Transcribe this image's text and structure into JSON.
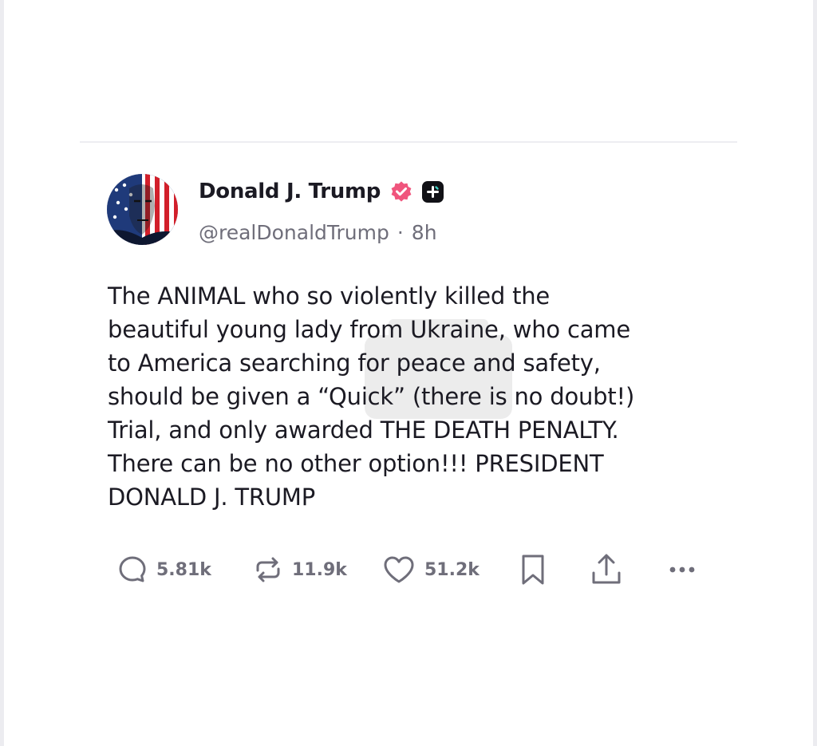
{
  "post": {
    "author_name": "Donald J. Trump",
    "handle": "@realDonaldTrump",
    "separator": "·",
    "time": "8h",
    "body_lines": [
      "The ANIMAL who so violently killed the",
      "beautiful young lady from Ukraine, who came",
      "to America searching for peace and safety,",
      "should be given a “Quick” (there is no doubt!)",
      "Trial, and only awarded THE DEATH PENALTY.",
      "There can be no other option!!! PRESIDENT",
      "DONALD J. TRUMP"
    ]
  },
  "actions": {
    "replies": "5.81k",
    "retruths": "11.9k",
    "likes": "51.2k"
  },
  "icons": {
    "verified": "verified-badge-icon",
    "plus": "plus-badge-icon",
    "reply": "comment-icon",
    "retruth": "repost-icon",
    "like": "heart-icon",
    "bookmark": "bookmark-icon",
    "share": "share-icon",
    "more": "more-icon"
  },
  "colors": {
    "text": "#1b1a23",
    "muted": "#6f6e7a",
    "verified": "#f0557d",
    "divider": "#ededf1"
  }
}
